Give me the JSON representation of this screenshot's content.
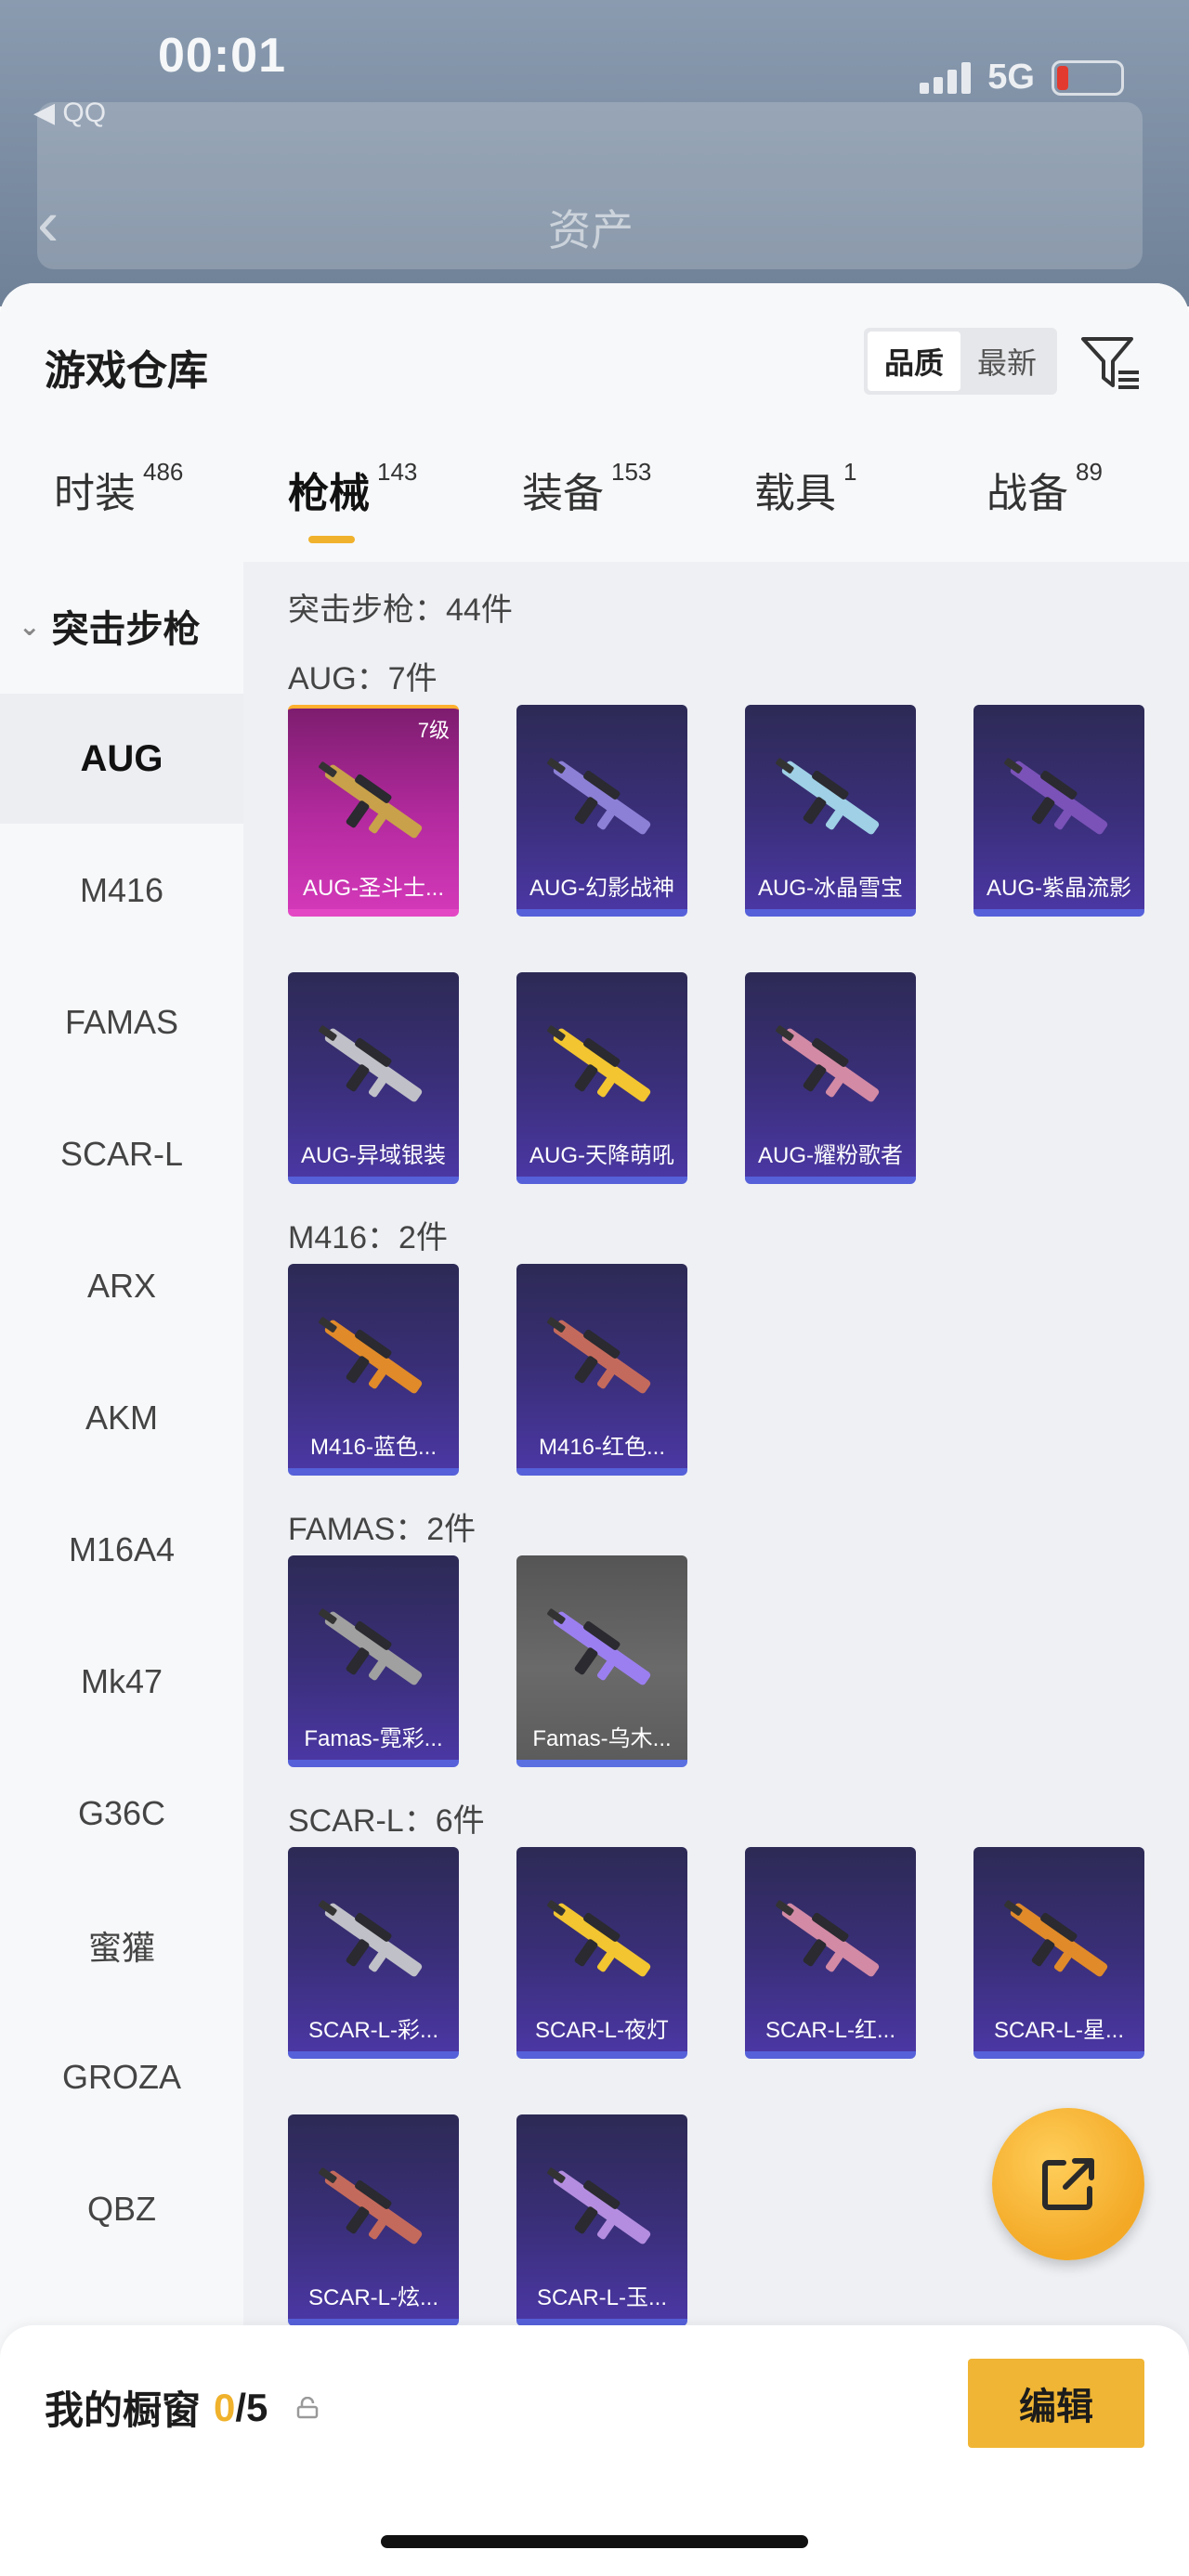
{
  "status_bar": {
    "time": "00:01",
    "back_app": "◀ QQ",
    "network": "5G",
    "battery_color": "#e23a2e"
  },
  "background_page": {
    "title": "资产"
  },
  "sheet": {
    "title": "游戏仓库",
    "sort_options": [
      "品质",
      "最新"
    ],
    "sort_selected": "品质"
  },
  "tabs": [
    {
      "label": "时装",
      "count": "486"
    },
    {
      "label": "枪械",
      "count": "143"
    },
    {
      "label": "装备",
      "count": "153"
    },
    {
      "label": "载具",
      "count": "1"
    },
    {
      "label": "战备",
      "count": "89"
    }
  ],
  "sidebar": {
    "group_label": "突击步枪",
    "items": [
      "AUG",
      "M416",
      "FAMAS",
      "SCAR-L",
      "ARX",
      "AKM",
      "M16A4",
      "Mk47",
      "G36C",
      "蜜獾",
      "GROZA",
      "QBZ"
    ],
    "selected": "AUG"
  },
  "content": {
    "category_summary": "突击步枪：44件",
    "sections": [
      {
        "label": "AUG：7件",
        "items": [
          {
            "name": "AUG-圣斗士...",
            "level": "7级",
            "rarity": "legendary"
          },
          {
            "name": "AUG-幻影战神",
            "rarity": "epic"
          },
          {
            "name": "AUG-冰晶雪宝",
            "rarity": "epic"
          },
          {
            "name": "AUG-紫晶流影",
            "rarity": "epic"
          },
          {
            "name": "AUG-异域银装",
            "rarity": "epic"
          },
          {
            "name": "AUG-天降萌吼",
            "rarity": "epic"
          },
          {
            "name": "AUG-耀粉歌者",
            "rarity": "epic"
          }
        ]
      },
      {
        "label": "M416：2件",
        "items": [
          {
            "name": "M416-蓝色...",
            "rarity": "epic"
          },
          {
            "name": "M416-红色...",
            "rarity": "epic"
          }
        ]
      },
      {
        "label": "FAMAS：2件",
        "items": [
          {
            "name": "Famas-霓彩...",
            "rarity": "epic"
          },
          {
            "name": "Famas-乌木...",
            "rarity": "common"
          }
        ]
      },
      {
        "label": "SCAR-L：6件",
        "items": [
          {
            "name": "SCAR-L-彩...",
            "rarity": "epic"
          },
          {
            "name": "SCAR-L-夜灯",
            "rarity": "epic"
          },
          {
            "name": "SCAR-L-红...",
            "rarity": "epic"
          },
          {
            "name": "SCAR-L-星...",
            "rarity": "epic"
          },
          {
            "name": "SCAR-L-炫...",
            "rarity": "epic"
          },
          {
            "name": "SCAR-L-玉...",
            "rarity": "epic"
          }
        ]
      }
    ]
  },
  "bottom_bar": {
    "label": "我的橱窗",
    "current": "0",
    "total": "/5",
    "edit_label": "编辑"
  },
  "colors": {
    "accent": "#f0b22c",
    "card_epic": "#3a2f7a",
    "card_legendary": "#b42a9f",
    "card_common": "#6a6a6a"
  }
}
